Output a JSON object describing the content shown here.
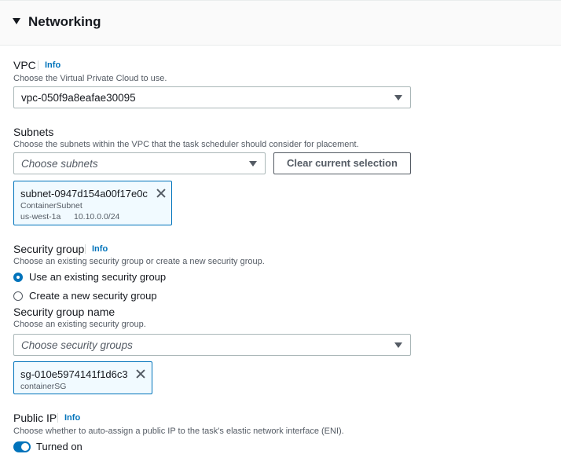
{
  "section": {
    "title": "Networking"
  },
  "vpc": {
    "label": "VPC",
    "info": "Info",
    "description": "Choose the Virtual Private Cloud to use.",
    "selected": "vpc-050f9a8eafae30095"
  },
  "subnets": {
    "label": "Subnets",
    "description": "Choose the subnets within the VPC that the task scheduler should consider for placement.",
    "placeholder": "Choose subnets",
    "clear_button": "Clear current selection",
    "token": {
      "id": "subnet-0947d154a00f17e0c",
      "name": "ContainerSubnet",
      "az": "us-west-1a",
      "cidr": "10.10.0.0/24"
    }
  },
  "security_group": {
    "label": "Security group",
    "info": "Info",
    "description": "Choose an existing security group or create a new security group.",
    "options": [
      {
        "label": "Use an existing security group",
        "selected": true
      },
      {
        "label": "Create a new security group",
        "selected": false
      }
    ],
    "name_label": "Security group name",
    "name_description": "Choose an existing security group.",
    "placeholder": "Choose security groups",
    "token": {
      "id": "sg-010e5974141f1d6c3",
      "name": "containerSG"
    }
  },
  "public_ip": {
    "label": "Public IP",
    "info": "Info",
    "description": "Choose whether to auto-assign a public IP to the task's elastic network interface (ENI).",
    "toggle_label": "Turned on",
    "enabled": true
  },
  "colors": {
    "accent": "#0073bb",
    "text": "#16191f",
    "muted": "#545b64"
  },
  "icons": [
    "caret-down-icon",
    "dropdown-arrow-icon",
    "close-icon",
    "radio-icon",
    "toggle-icon"
  ]
}
